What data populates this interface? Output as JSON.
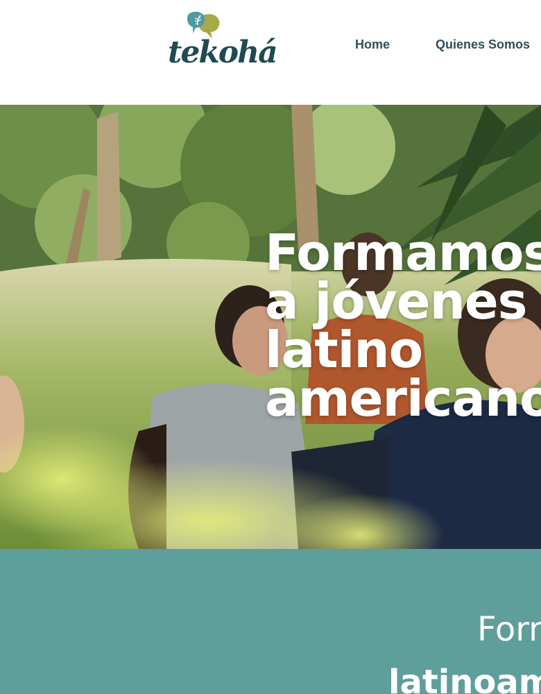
{
  "header": {
    "logo_text": "tekohá",
    "nav": [
      {
        "label": "Home"
      },
      {
        "label": "Quienes Somos"
      }
    ]
  },
  "hero": {
    "title": "Formamos\na jóvenes\nlatino\namericanos"
  },
  "band": {
    "line1": "Formamos a jóvenes",
    "line2": "latinoamericanos"
  },
  "colors": {
    "band": "#5e9e9b",
    "nav_text": "#2f4e5e",
    "logo_teal": "#4f9aa0",
    "logo_olive": "#a6a84a",
    "logo_text": "#1f4a52"
  }
}
